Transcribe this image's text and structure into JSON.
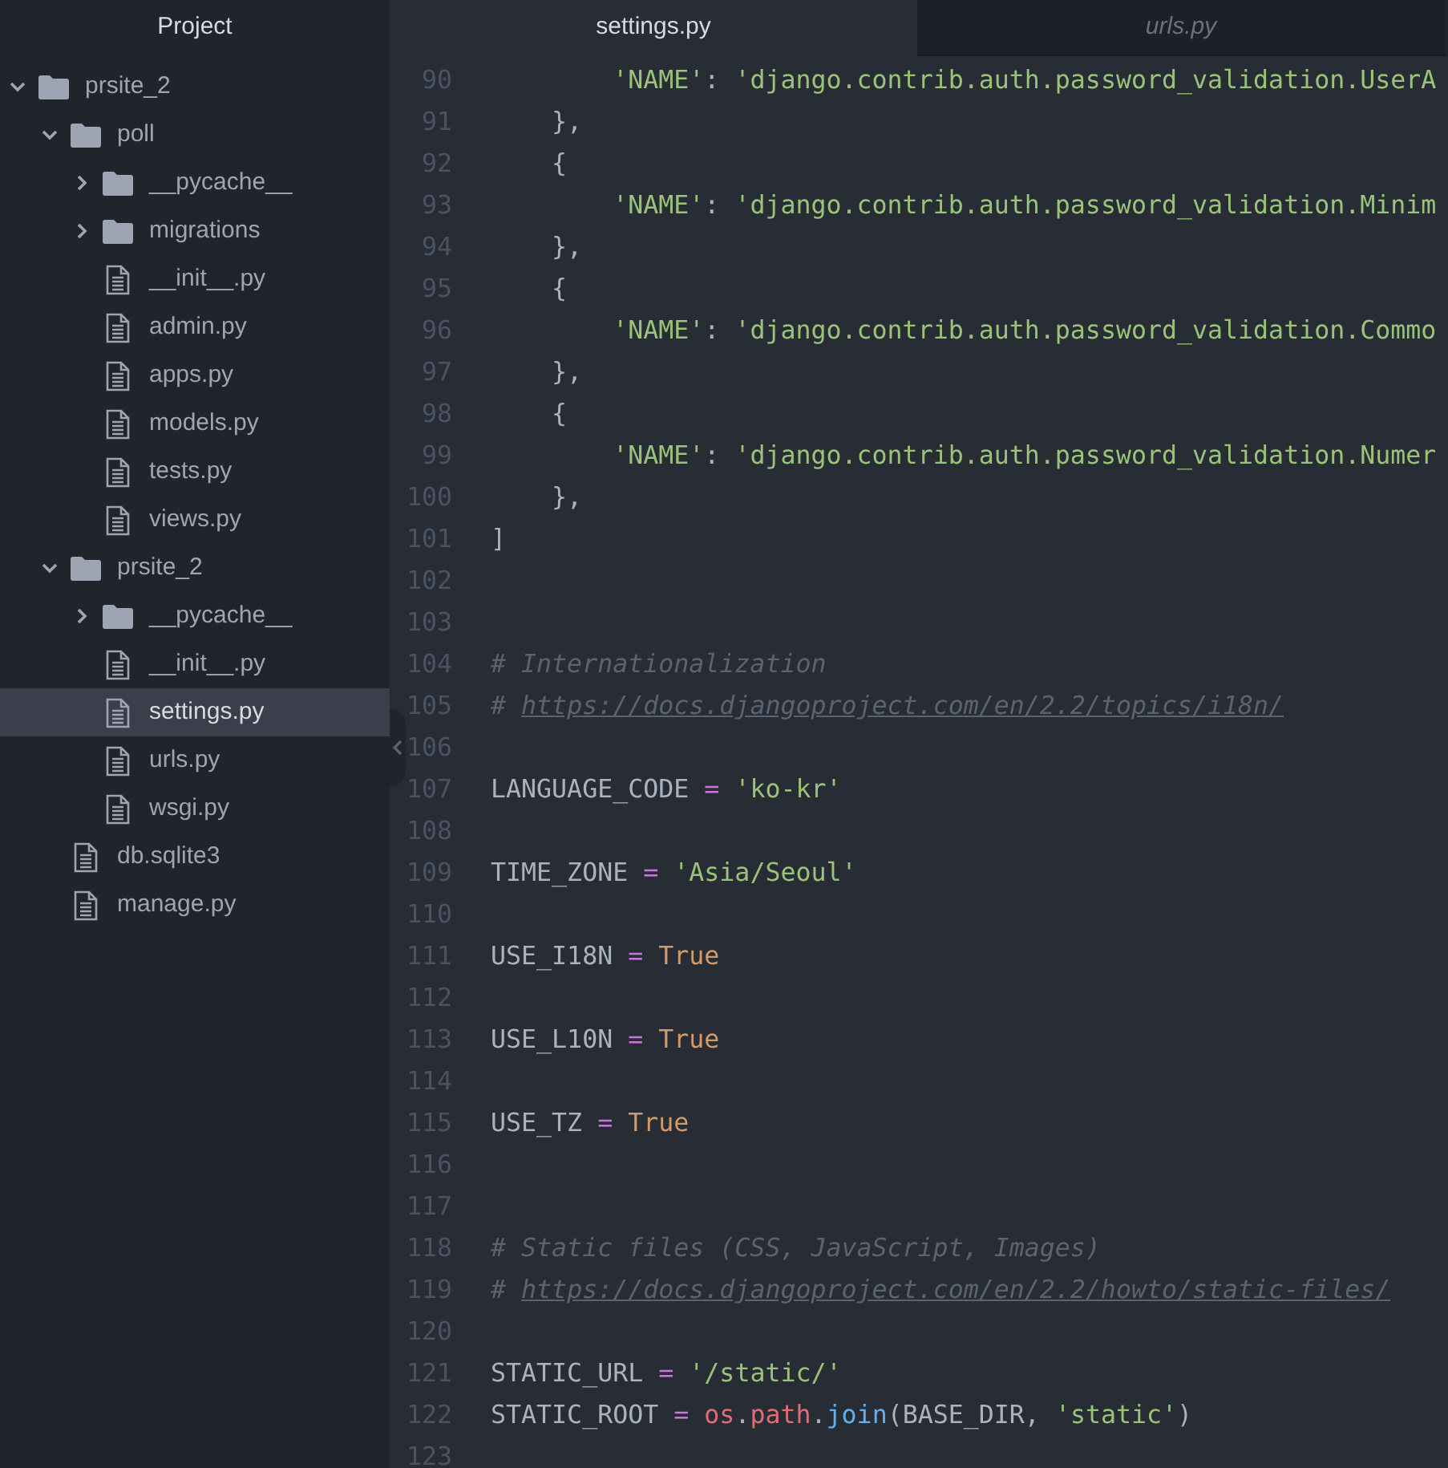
{
  "sidebar": {
    "title": "Project",
    "tree": [
      {
        "name": "prsite_2",
        "kind": "folder",
        "expanded": true,
        "selected": false,
        "children": [
          {
            "name": "poll",
            "kind": "folder",
            "expanded": true,
            "selected": false,
            "children": [
              {
                "name": "__pycache__",
                "kind": "folder",
                "expanded": false,
                "selected": false
              },
              {
                "name": "migrations",
                "kind": "folder",
                "expanded": false,
                "selected": false
              },
              {
                "name": "__init__.py",
                "kind": "file",
                "selected": false
              },
              {
                "name": "admin.py",
                "kind": "file",
                "selected": false
              },
              {
                "name": "apps.py",
                "kind": "file",
                "selected": false
              },
              {
                "name": "models.py",
                "kind": "file",
                "selected": false
              },
              {
                "name": "tests.py",
                "kind": "file",
                "selected": false
              },
              {
                "name": "views.py",
                "kind": "file",
                "selected": false
              }
            ]
          },
          {
            "name": "prsite_2",
            "kind": "folder",
            "expanded": true,
            "selected": false,
            "children": [
              {
                "name": "__pycache__",
                "kind": "folder",
                "expanded": false,
                "selected": false
              },
              {
                "name": "__init__.py",
                "kind": "file",
                "selected": false
              },
              {
                "name": "settings.py",
                "kind": "file",
                "selected": true
              },
              {
                "name": "urls.py",
                "kind": "file",
                "selected": false
              },
              {
                "name": "wsgi.py",
                "kind": "file",
                "selected": false
              }
            ]
          },
          {
            "name": "db.sqlite3",
            "kind": "file",
            "selected": false
          },
          {
            "name": "manage.py",
            "kind": "file",
            "selected": false
          }
        ]
      }
    ]
  },
  "tabs": [
    {
      "label": "settings.py",
      "selected": true
    },
    {
      "label": "urls.py",
      "selected": false
    }
  ],
  "editor": {
    "lines": [
      {
        "number": "90",
        "tokens": [
          {
            "kind": "string",
            "text": "        'NAME'"
          },
          {
            "kind": "plain",
            "text": ": "
          },
          {
            "kind": "string",
            "text": "'django.contrib.auth.password_validation.UserA"
          }
        ]
      },
      {
        "number": "91",
        "tokens": [
          {
            "kind": "plain",
            "text": "    },"
          }
        ]
      },
      {
        "number": "92",
        "tokens": [
          {
            "kind": "plain",
            "text": "    {"
          }
        ]
      },
      {
        "number": "93",
        "tokens": [
          {
            "kind": "string",
            "text": "        'NAME'"
          },
          {
            "kind": "plain",
            "text": ": "
          },
          {
            "kind": "string",
            "text": "'django.contrib.auth.password_validation.Minim"
          }
        ]
      },
      {
        "number": "94",
        "tokens": [
          {
            "kind": "plain",
            "text": "    },"
          }
        ]
      },
      {
        "number": "95",
        "tokens": [
          {
            "kind": "plain",
            "text": "    {"
          }
        ]
      },
      {
        "number": "96",
        "tokens": [
          {
            "kind": "string",
            "text": "        'NAME'"
          },
          {
            "kind": "plain",
            "text": ": "
          },
          {
            "kind": "string",
            "text": "'django.contrib.auth.password_validation.Commo"
          }
        ]
      },
      {
        "number": "97",
        "tokens": [
          {
            "kind": "plain",
            "text": "    },"
          }
        ]
      },
      {
        "number": "98",
        "tokens": [
          {
            "kind": "plain",
            "text": "    {"
          }
        ]
      },
      {
        "number": "99",
        "tokens": [
          {
            "kind": "string",
            "text": "        'NAME'"
          },
          {
            "kind": "plain",
            "text": ": "
          },
          {
            "kind": "string",
            "text": "'django.contrib.auth.password_validation.Numer"
          }
        ]
      },
      {
        "number": "100",
        "tokens": [
          {
            "kind": "plain",
            "text": "    },"
          }
        ]
      },
      {
        "number": "101",
        "tokens": [
          {
            "kind": "plain",
            "text": "]"
          }
        ]
      },
      {
        "number": "102"
      },
      {
        "number": "103"
      },
      {
        "number": "104",
        "tokens": [
          {
            "kind": "comment",
            "text": "# Internationalization"
          }
        ]
      },
      {
        "number": "105",
        "tokens": [
          {
            "kind": "comment",
            "text": "# "
          },
          {
            "kind": "link",
            "text": "https://docs.djangoproject.com/en/2.2/topics/i18n/"
          }
        ]
      },
      {
        "number": "106"
      },
      {
        "number": "107",
        "tokens": [
          {
            "kind": "plain",
            "text": "LANGUAGE_CODE "
          },
          {
            "kind": "operator",
            "text": "= "
          },
          {
            "kind": "string",
            "text": "'ko-kr'"
          }
        ]
      },
      {
        "number": "108"
      },
      {
        "number": "109",
        "tokens": [
          {
            "kind": "plain",
            "text": "TIME_ZONE "
          },
          {
            "kind": "operator",
            "text": "= "
          },
          {
            "kind": "string",
            "text": "'Asia/Seoul'"
          }
        ]
      },
      {
        "number": "110"
      },
      {
        "number": "111",
        "tokens": [
          {
            "kind": "plain",
            "text": "USE_I18N "
          },
          {
            "kind": "operator",
            "text": "= "
          },
          {
            "kind": "constant",
            "text": "True"
          }
        ]
      },
      {
        "number": "112"
      },
      {
        "number": "113",
        "tokens": [
          {
            "kind": "plain",
            "text": "USE_L10N "
          },
          {
            "kind": "operator",
            "text": "= "
          },
          {
            "kind": "constant",
            "text": "True"
          }
        ]
      },
      {
        "number": "114"
      },
      {
        "number": "115",
        "tokens": [
          {
            "kind": "plain",
            "text": "USE_TZ "
          },
          {
            "kind": "operator",
            "text": "= "
          },
          {
            "kind": "constant",
            "text": "True"
          }
        ]
      },
      {
        "number": "116"
      },
      {
        "number": "117"
      },
      {
        "number": "118",
        "tokens": [
          {
            "kind": "comment",
            "text": "# Static files (CSS, JavaScript, Images)"
          }
        ]
      },
      {
        "number": "119",
        "tokens": [
          {
            "kind": "comment",
            "text": "# "
          },
          {
            "kind": "link",
            "text": "https://docs.djangoproject.com/en/2.2/howto/static-files/"
          }
        ]
      },
      {
        "number": "120"
      },
      {
        "number": "121",
        "tokens": [
          {
            "kind": "plain",
            "text": "STATIC_URL "
          },
          {
            "kind": "operator",
            "text": "= "
          },
          {
            "kind": "string",
            "text": "'/static/'"
          }
        ]
      },
      {
        "number": "122",
        "tokens": [
          {
            "kind": "plain",
            "text": "STATIC_ROOT "
          },
          {
            "kind": "operator",
            "text": "= "
          },
          {
            "kind": "variable",
            "text": "os"
          },
          {
            "kind": "plain",
            "text": "."
          },
          {
            "kind": "variable",
            "text": "path"
          },
          {
            "kind": "plain",
            "text": "."
          },
          {
            "kind": "function",
            "text": "join"
          },
          {
            "kind": "plain",
            "text": "(BASE_DIR, "
          },
          {
            "kind": "string",
            "text": "'static'"
          },
          {
            "kind": "plain",
            "text": ")"
          }
        ]
      },
      {
        "number": "123"
      }
    ]
  }
}
